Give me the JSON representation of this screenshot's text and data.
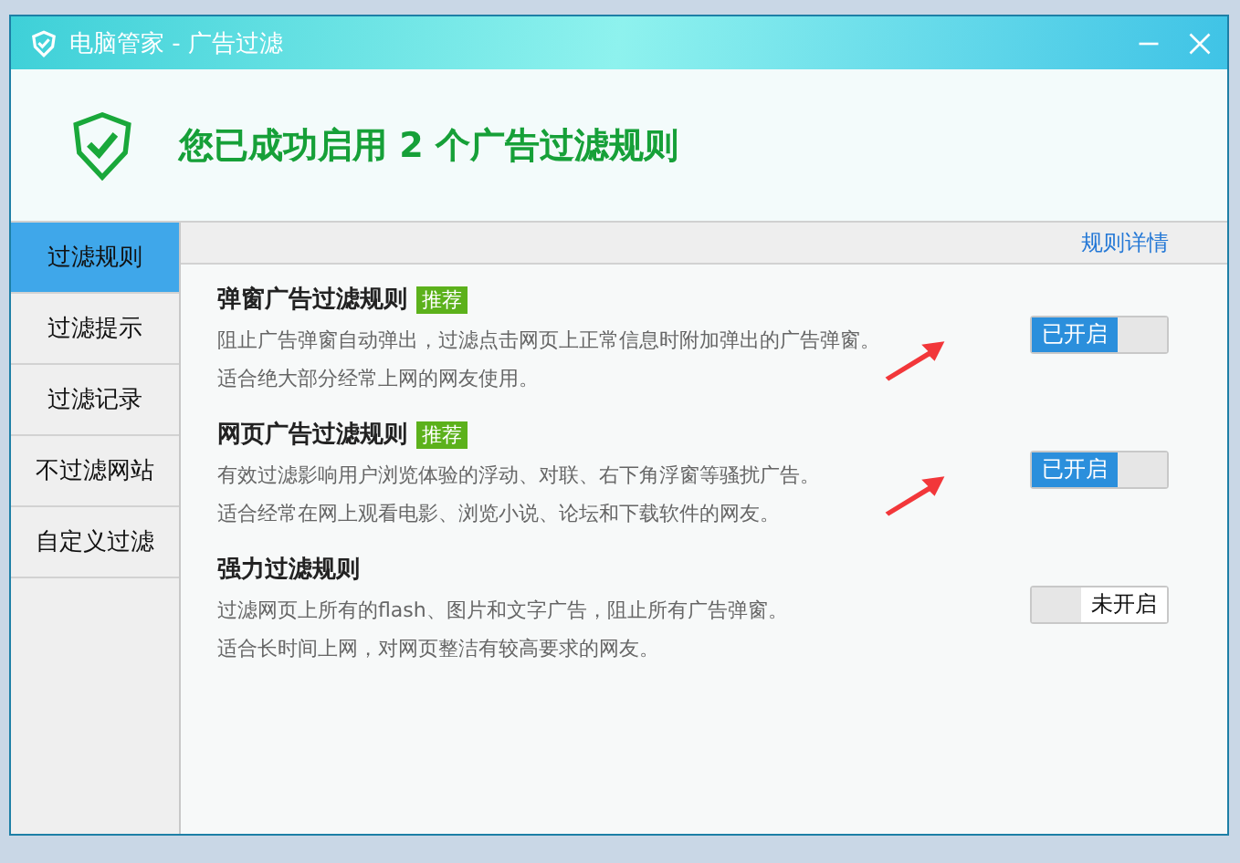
{
  "window": {
    "title": "电脑管家 - 广告过滤"
  },
  "header": {
    "message": "您已成功启用 2 个广告过滤规则"
  },
  "sidebar": {
    "items": [
      {
        "label": "过滤规则",
        "selected": true
      },
      {
        "label": "过滤提示",
        "selected": false
      },
      {
        "label": "过滤记录",
        "selected": false
      },
      {
        "label": "不过滤网站",
        "selected": false
      },
      {
        "label": "自定义过滤",
        "selected": false
      }
    ]
  },
  "toolbar": {
    "link": "规则详情"
  },
  "rules": [
    {
      "title": "弹窗广告过滤规则",
      "badge": "推荐",
      "lines": [
        "阻止广告弹窗自动弹出，过滤点击网页上正常信息时附加弹出的广告弹窗。",
        "适合绝大部分经常上网的网友使用。"
      ],
      "on": true,
      "switch_label": "已开启"
    },
    {
      "title": "网页广告过滤规则",
      "badge": "推荐",
      "lines": [
        "有效过滤影响用户浏览体验的浮动、对联、右下角浮窗等骚扰广告。",
        "适合经常在网上观看电影、浏览小说、论坛和下载软件的网友。"
      ],
      "on": true,
      "switch_label": "已开启"
    },
    {
      "title": "强力过滤规则",
      "lines": [
        "过滤网页上所有的flash、图片和文字广告，阻止所有广告弹窗。",
        "适合长时间上网，对网页整洁有较高要求的网友。"
      ],
      "on": false,
      "switch_label": "未开启"
    }
  ]
}
